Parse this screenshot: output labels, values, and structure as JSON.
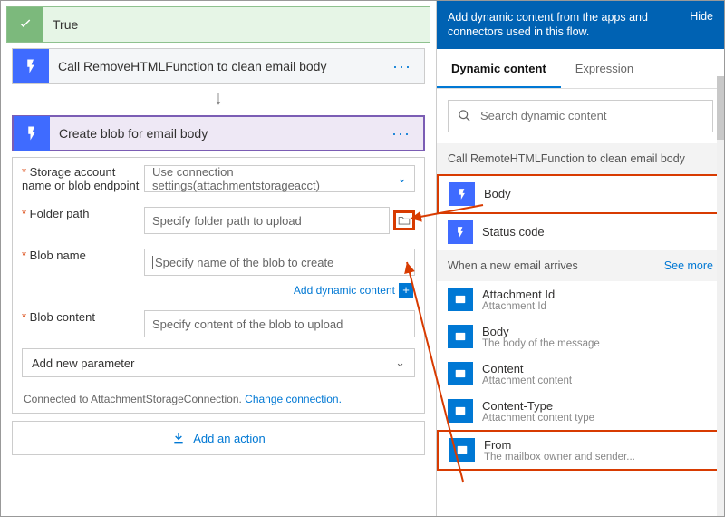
{
  "condition": {
    "label": "True"
  },
  "step_call": {
    "title": "Call RemoveHTMLFunction to clean email body"
  },
  "step_create": {
    "title": "Create blob for email body"
  },
  "form": {
    "storage": {
      "label": "Storage account name or blob endpoint",
      "value": "Use connection settings(attachmentstorageacct)"
    },
    "folder": {
      "label": "Folder path",
      "placeholder": "Specify folder path to upload"
    },
    "blobname": {
      "label": "Blob name",
      "placeholder": "Specify name of the blob to create"
    },
    "content": {
      "label": "Blob content",
      "placeholder": "Specify content of the blob to upload"
    },
    "dyn_link": "Add dynamic content",
    "param": "Add new parameter",
    "connected_text": "Connected to AttachmentStorageConnection. ",
    "change_link": "Change connection."
  },
  "add_action": "Add an action",
  "panel": {
    "header": "Add dynamic content from the apps and connectors used in this flow.",
    "hide": "Hide",
    "tabs": {
      "dynamic": "Dynamic content",
      "expression": "Expression"
    },
    "search_placeholder": "Search dynamic content",
    "sec1_title": "Call RemoteHTMLFunction to clean email body",
    "sec1_items": {
      "body": "Body",
      "status": "Status code"
    },
    "sec2_title": "When a new email arrives",
    "see_more": "See more",
    "sec2_items": {
      "att_id": {
        "t": "Attachment Id",
        "s": "Attachment Id"
      },
      "body": {
        "t": "Body",
        "s": "The body of the message"
      },
      "content": {
        "t": "Content",
        "s": "Attachment content"
      },
      "ctype": {
        "t": "Content-Type",
        "s": "Attachment content type"
      },
      "from": {
        "t": "From",
        "s": "The mailbox owner and sender..."
      }
    }
  }
}
